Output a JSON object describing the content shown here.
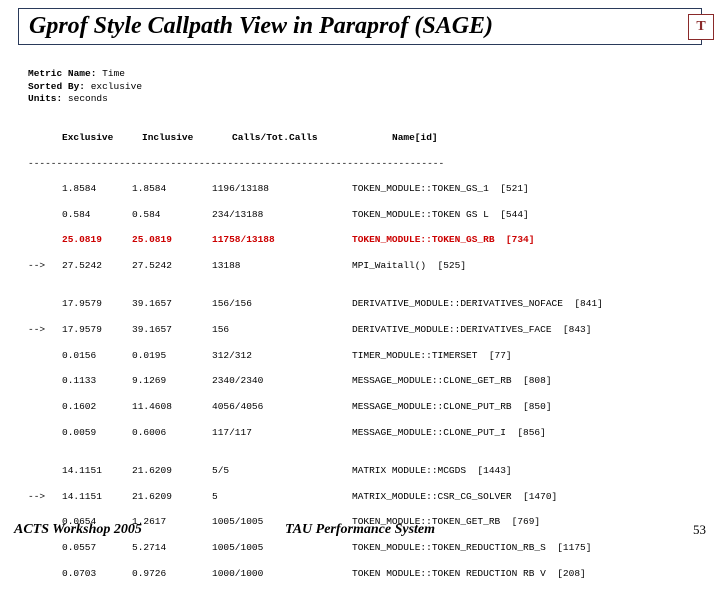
{
  "title": "Gprof Style Callpath View in Paraprof (SAGE)",
  "corner_logo": "T",
  "meta": {
    "metric_label": "Metric Name:",
    "metric_value": "Time",
    "sorted_label": "Sorted By:",
    "sorted_value": "exclusive",
    "units_label": "Units:",
    "units_value": "seconds"
  },
  "columns": {
    "exclusive": "Exclusive",
    "inclusive": "Inclusive",
    "calls": "Calls/Tot.Calls",
    "name": "Name[id]"
  },
  "dashes": "-------------------------------------------------------------------------",
  "groups": [
    {
      "rows": [
        {
          "arrow": "",
          "excl": "1.8584",
          "incl": "1.8584",
          "calls": "1196/13188",
          "name": "TOKEN_MODULE::TOKEN_GS_1  [521]",
          "hl": false
        },
        {
          "arrow": "",
          "excl": "0.584",
          "incl": "0.584",
          "calls": "234/13188",
          "name": "TOKEN_MODULE::TOKEN GS L  [544]",
          "hl": false
        },
        {
          "arrow": "",
          "excl": "25.0819",
          "incl": "25.0819",
          "calls": "11758/13188",
          "name": "TOKEN_MODULE::TOKEN_GS_RB  [734]",
          "hl": true
        },
        {
          "arrow": "-->",
          "excl": "27.5242",
          "incl": "27.5242",
          "calls": "13188",
          "name": "MPI_Waitall()  [525]",
          "hl": false
        }
      ]
    },
    {
      "rows": [
        {
          "arrow": "",
          "excl": "17.9579",
          "incl": "39.1657",
          "calls": "156/156",
          "name": "DERIVATIVE_MODULE::DERIVATIVES_NOFACE  [841]",
          "hl": false
        },
        {
          "arrow": "-->",
          "excl": "17.9579",
          "incl": "39.1657",
          "calls": "156",
          "name": "DERIVATIVE_MODULE::DERIVATIVES_FACE  [843]",
          "hl": false
        },
        {
          "arrow": "",
          "excl": "0.0156",
          "incl": "0.0195",
          "calls": "312/312",
          "name": "TIMER_MODULE::TIMERSET  [77]",
          "hl": false
        },
        {
          "arrow": "",
          "excl": "0.1133",
          "incl": "9.1269",
          "calls": "2340/2340",
          "name": "MESSAGE_MODULE::CLONE_GET_RB  [808]",
          "hl": false
        },
        {
          "arrow": "",
          "excl": "0.1602",
          "incl": "11.4608",
          "calls": "4056/4056",
          "name": "MESSAGE_MODULE::CLONE_PUT_RB  [850]",
          "hl": false
        },
        {
          "arrow": "",
          "excl": "0.0059",
          "incl": "0.6006",
          "calls": "117/117",
          "name": "MESSAGE_MODULE::CLONE_PUT_I  [856]",
          "hl": false
        }
      ]
    },
    {
      "rows": [
        {
          "arrow": "",
          "excl": "14.1151",
          "incl": "21.6209",
          "calls": "5/5",
          "name": "MATRIX MODULE::MCGDS  [1443]",
          "hl": false
        },
        {
          "arrow": "-->",
          "excl": "14.1151",
          "incl": "21.6209",
          "calls": "5",
          "name": "MATRIX_MODULE::CSR_CG_SOLVER  [1470]",
          "hl": false
        },
        {
          "arrow": "",
          "excl": "0.0654",
          "incl": "1.2617",
          "calls": "1005/1005",
          "name": "TOKEN_MODULE::TOKEN_GET_RB  [769]",
          "hl": false
        },
        {
          "arrow": "",
          "excl": "0.0557",
          "incl": "5.2714",
          "calls": "1005/1005",
          "name": "TOKEN_MODULE::TOKEN_REDUCTION_RB_S  [1175]",
          "hl": false
        },
        {
          "arrow": "",
          "excl": "0.0703",
          "incl": "0.9726",
          "calls": "1000/1000",
          "name": "TOKEN MODULE::TOKEN REDUCTION RB V  [208]",
          "hl": false
        }
      ]
    }
  ],
  "footer": {
    "left": "ACTS Workshop 2005",
    "center": "TAU Performance System",
    "page": "53"
  }
}
